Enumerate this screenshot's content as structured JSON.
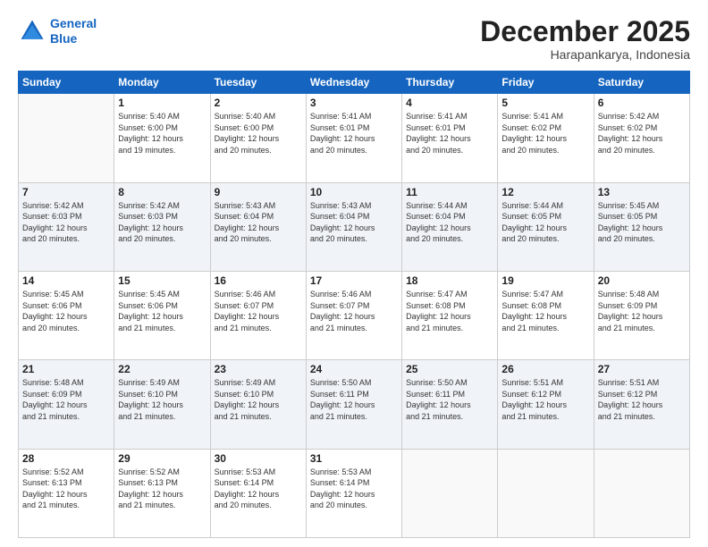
{
  "logo": {
    "line1": "General",
    "line2": "Blue"
  },
  "title": "December 2025",
  "subtitle": "Harapankarya, Indonesia",
  "weekdays": [
    "Sunday",
    "Monday",
    "Tuesday",
    "Wednesday",
    "Thursday",
    "Friday",
    "Saturday"
  ],
  "weeks": [
    [
      {
        "day": "",
        "info": ""
      },
      {
        "day": "1",
        "info": "Sunrise: 5:40 AM\nSunset: 6:00 PM\nDaylight: 12 hours\nand 19 minutes."
      },
      {
        "day": "2",
        "info": "Sunrise: 5:40 AM\nSunset: 6:00 PM\nDaylight: 12 hours\nand 20 minutes."
      },
      {
        "day": "3",
        "info": "Sunrise: 5:41 AM\nSunset: 6:01 PM\nDaylight: 12 hours\nand 20 minutes."
      },
      {
        "day": "4",
        "info": "Sunrise: 5:41 AM\nSunset: 6:01 PM\nDaylight: 12 hours\nand 20 minutes."
      },
      {
        "day": "5",
        "info": "Sunrise: 5:41 AM\nSunset: 6:02 PM\nDaylight: 12 hours\nand 20 minutes."
      },
      {
        "day": "6",
        "info": "Sunrise: 5:42 AM\nSunset: 6:02 PM\nDaylight: 12 hours\nand 20 minutes."
      }
    ],
    [
      {
        "day": "7",
        "info": "Sunrise: 5:42 AM\nSunset: 6:03 PM\nDaylight: 12 hours\nand 20 minutes."
      },
      {
        "day": "8",
        "info": "Sunrise: 5:42 AM\nSunset: 6:03 PM\nDaylight: 12 hours\nand 20 minutes."
      },
      {
        "day": "9",
        "info": "Sunrise: 5:43 AM\nSunset: 6:04 PM\nDaylight: 12 hours\nand 20 minutes."
      },
      {
        "day": "10",
        "info": "Sunrise: 5:43 AM\nSunset: 6:04 PM\nDaylight: 12 hours\nand 20 minutes."
      },
      {
        "day": "11",
        "info": "Sunrise: 5:44 AM\nSunset: 6:04 PM\nDaylight: 12 hours\nand 20 minutes."
      },
      {
        "day": "12",
        "info": "Sunrise: 5:44 AM\nSunset: 6:05 PM\nDaylight: 12 hours\nand 20 minutes."
      },
      {
        "day": "13",
        "info": "Sunrise: 5:45 AM\nSunset: 6:05 PM\nDaylight: 12 hours\nand 20 minutes."
      }
    ],
    [
      {
        "day": "14",
        "info": "Sunrise: 5:45 AM\nSunset: 6:06 PM\nDaylight: 12 hours\nand 20 minutes."
      },
      {
        "day": "15",
        "info": "Sunrise: 5:45 AM\nSunset: 6:06 PM\nDaylight: 12 hours\nand 21 minutes."
      },
      {
        "day": "16",
        "info": "Sunrise: 5:46 AM\nSunset: 6:07 PM\nDaylight: 12 hours\nand 21 minutes."
      },
      {
        "day": "17",
        "info": "Sunrise: 5:46 AM\nSunset: 6:07 PM\nDaylight: 12 hours\nand 21 minutes."
      },
      {
        "day": "18",
        "info": "Sunrise: 5:47 AM\nSunset: 6:08 PM\nDaylight: 12 hours\nand 21 minutes."
      },
      {
        "day": "19",
        "info": "Sunrise: 5:47 AM\nSunset: 6:08 PM\nDaylight: 12 hours\nand 21 minutes."
      },
      {
        "day": "20",
        "info": "Sunrise: 5:48 AM\nSunset: 6:09 PM\nDaylight: 12 hours\nand 21 minutes."
      }
    ],
    [
      {
        "day": "21",
        "info": "Sunrise: 5:48 AM\nSunset: 6:09 PM\nDaylight: 12 hours\nand 21 minutes."
      },
      {
        "day": "22",
        "info": "Sunrise: 5:49 AM\nSunset: 6:10 PM\nDaylight: 12 hours\nand 21 minutes."
      },
      {
        "day": "23",
        "info": "Sunrise: 5:49 AM\nSunset: 6:10 PM\nDaylight: 12 hours\nand 21 minutes."
      },
      {
        "day": "24",
        "info": "Sunrise: 5:50 AM\nSunset: 6:11 PM\nDaylight: 12 hours\nand 21 minutes."
      },
      {
        "day": "25",
        "info": "Sunrise: 5:50 AM\nSunset: 6:11 PM\nDaylight: 12 hours\nand 21 minutes."
      },
      {
        "day": "26",
        "info": "Sunrise: 5:51 AM\nSunset: 6:12 PM\nDaylight: 12 hours\nand 21 minutes."
      },
      {
        "day": "27",
        "info": "Sunrise: 5:51 AM\nSunset: 6:12 PM\nDaylight: 12 hours\nand 21 minutes."
      }
    ],
    [
      {
        "day": "28",
        "info": "Sunrise: 5:52 AM\nSunset: 6:13 PM\nDaylight: 12 hours\nand 21 minutes."
      },
      {
        "day": "29",
        "info": "Sunrise: 5:52 AM\nSunset: 6:13 PM\nDaylight: 12 hours\nand 21 minutes."
      },
      {
        "day": "30",
        "info": "Sunrise: 5:53 AM\nSunset: 6:14 PM\nDaylight: 12 hours\nand 20 minutes."
      },
      {
        "day": "31",
        "info": "Sunrise: 5:53 AM\nSunset: 6:14 PM\nDaylight: 12 hours\nand 20 minutes."
      },
      {
        "day": "",
        "info": ""
      },
      {
        "day": "",
        "info": ""
      },
      {
        "day": "",
        "info": ""
      }
    ]
  ]
}
